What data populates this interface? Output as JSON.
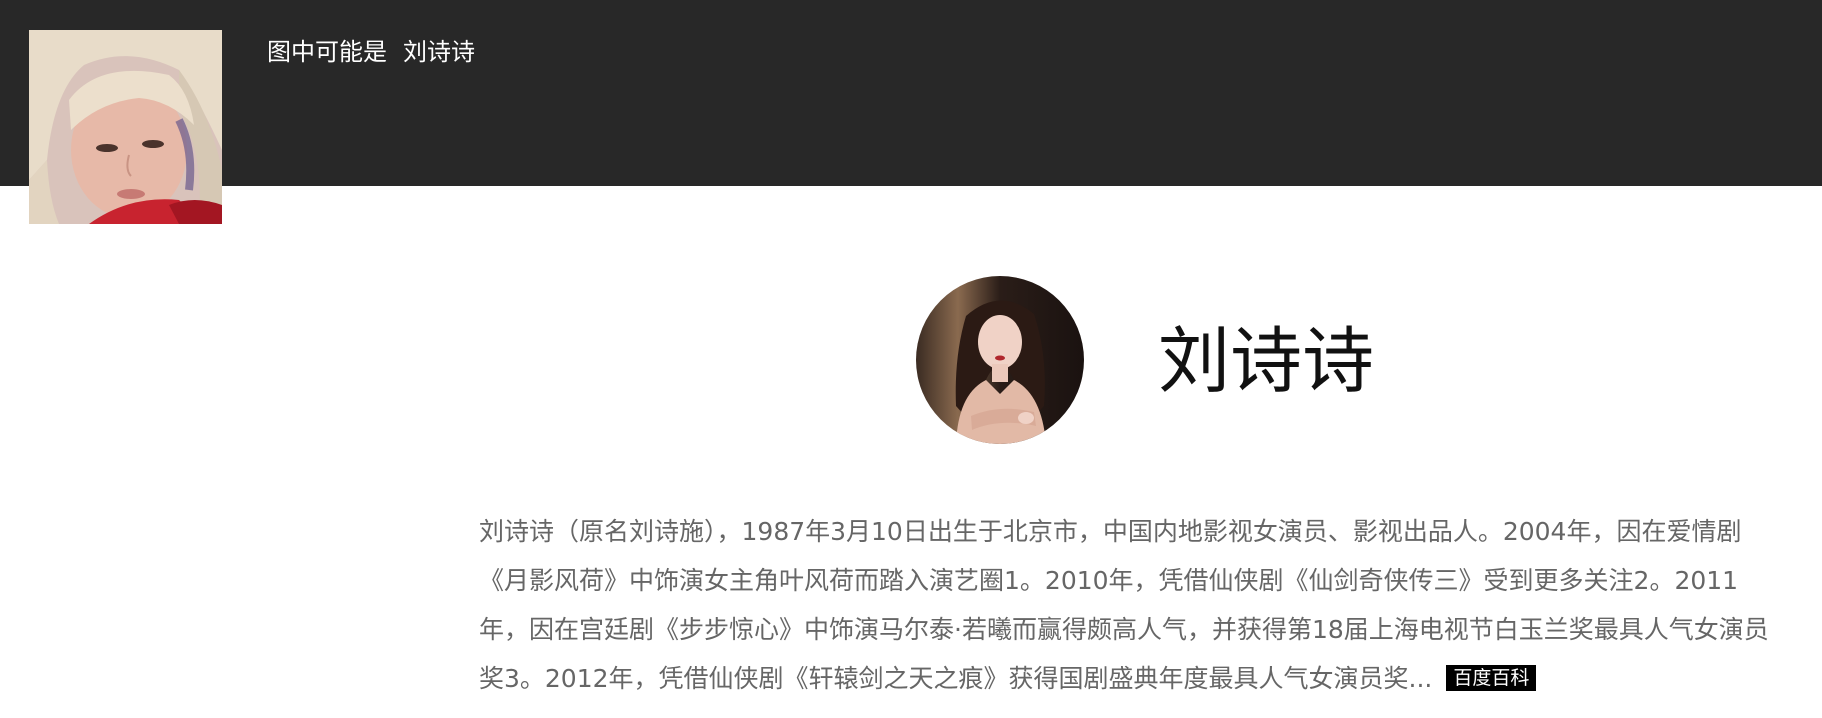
{
  "header": {
    "caption_prefix": "图中可能是",
    "caption_name": "刘诗诗"
  },
  "profile": {
    "name": "刘诗诗",
    "bio": "刘诗诗（原名刘诗施），1987年3月10日出生于北京市，中国内地影视女演员、影视出品人。2004年，因在爱情剧《月影风荷》中饰演女主角叶风荷而踏入演艺圈1。2010年，凭借仙侠剧《仙剑奇侠传三》受到更多关注2。2011年，因在宫廷剧《步步惊心》中饰演马尔泰·若曦而赢得颇高人气，并获得第18届上海电视节白玉兰奖最具人气女演员奖3。2012年，凭借仙侠剧《轩辕剑之天之痕》获得国剧盛典年度最具人气女演员奖...",
    "source_label": "百度百科"
  },
  "colors": {
    "header_bg": "#282828",
    "body_text": "#666666",
    "title_text": "#111111",
    "badge_bg": "#000000"
  }
}
